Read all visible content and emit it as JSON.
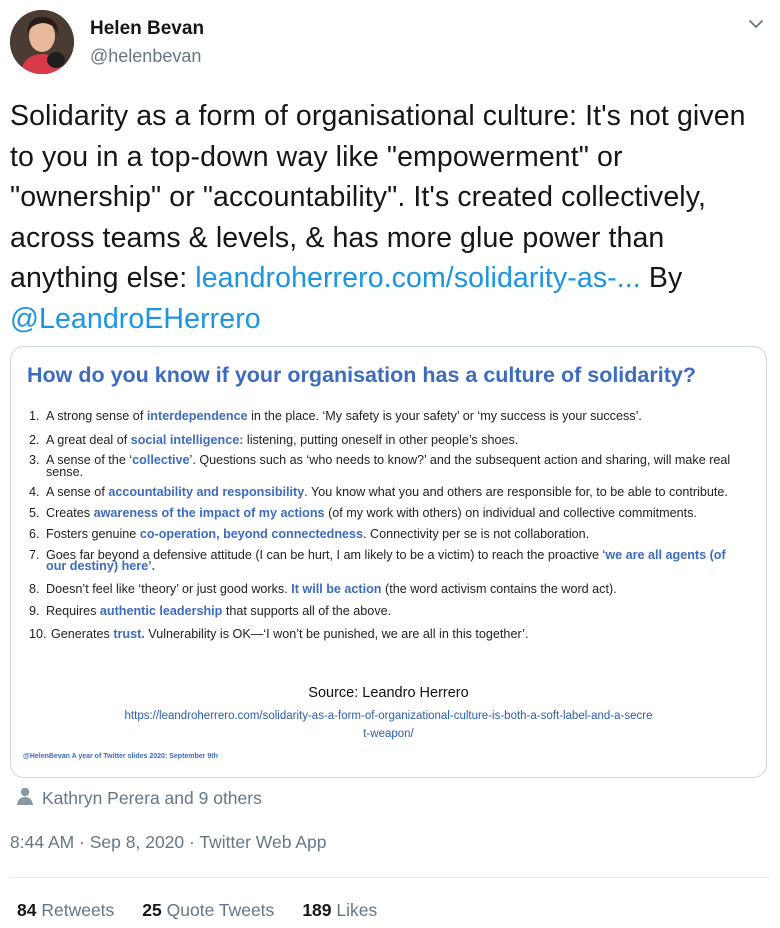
{
  "author": {
    "name": "Helen Bevan",
    "handle": "@helenbevan"
  },
  "tweet": {
    "text_before": "Solidarity as a form of organisational culture: It's not given to you in a top-down way like \"empowerment\" or \"ownership\" or \"accountability\". It's created collectively, across teams & levels, & has more glue power than anything else: ",
    "link_text": "leandroherrero.com/solidarity-as-...",
    "text_by": " By",
    "mention": "@LeandroEHerrero"
  },
  "slide": {
    "title": "How do you know if your organisation has a culture of solidarity?",
    "items": [
      {
        "num": "1.",
        "pre": "A strong sense of ",
        "hl": "interdependence",
        "post": " in the place. ‘My safety is your safety’ or ‘my success is your success’."
      },
      {
        "num": "2.",
        "pre": "A great deal of ",
        "hl": "social intelligence:",
        "post": " listening, putting oneself in other people’s shoes."
      },
      {
        "num": "3.",
        "pre": "A sense of the ‘",
        "hl": "collective",
        "post": "’. Questions such as ‘who needs to know?’ and the subsequent action and sharing, will make real sense."
      },
      {
        "num": "4.",
        "pre": "A sense of ",
        "hl": "accountability and responsibility",
        "post": ". You know what you and others are responsible for, to be able to contribute."
      },
      {
        "num": "5.",
        "pre": "Creates ",
        "hl": "awareness of the impact of my actions",
        "post": " (of my work with others) on individual and collective commitments."
      },
      {
        "num": "6.",
        "pre": "Fosters genuine ",
        "hl": "co-operation, beyond connectedness",
        "post": ". Connectivity per se is not collaboration."
      },
      {
        "num": "7.",
        "pre": "Goes far beyond a defensive attitude (I can be hurt, I am likely to be a victim) to reach the proactive ‘",
        "hl": "we are all agents (of our destiny) here’.",
        "post": ""
      },
      {
        "num": "8.",
        "pre": "Doesn’t feel like ‘theory’ or just good works. ",
        "hl": "It will be action",
        "post": " (the word activism contains the word act)."
      },
      {
        "num": "9.",
        "pre": "Requires ",
        "hl": "authentic leadership",
        "post": " that supports all of the above."
      },
      {
        "num": "10.",
        "pre": "Generates ",
        "hl": "trust.",
        "post": " Vulnerability is OK—‘I won’t be punished, we are all in this together’."
      }
    ],
    "source": "Source: Leandro Herrero",
    "source_url": "https://leandroherrero.com/solidarity-as-a-form-of-organizational-culture-is-both-a-soft-label-and-a-secret-weapon/",
    "footer": "@HelenBevan A year of Twitter slides 2020: September 9th"
  },
  "likers": "Kathryn Perera and 9 others",
  "meta": "8:44 AM · Sep 8, 2020 · Twitter Web App",
  "stats": {
    "retweets_count": "84",
    "retweets_label": "Retweets",
    "quotes_count": "25",
    "quotes_label": "Quote Tweets",
    "likes_count": "189",
    "likes_label": "Likes"
  },
  "icons": [
    "chevron-down-icon",
    "person-icon"
  ],
  "colors": {
    "link": "#1b95e0",
    "slide_accent": "#3d6bbf",
    "muted": "#657786"
  }
}
